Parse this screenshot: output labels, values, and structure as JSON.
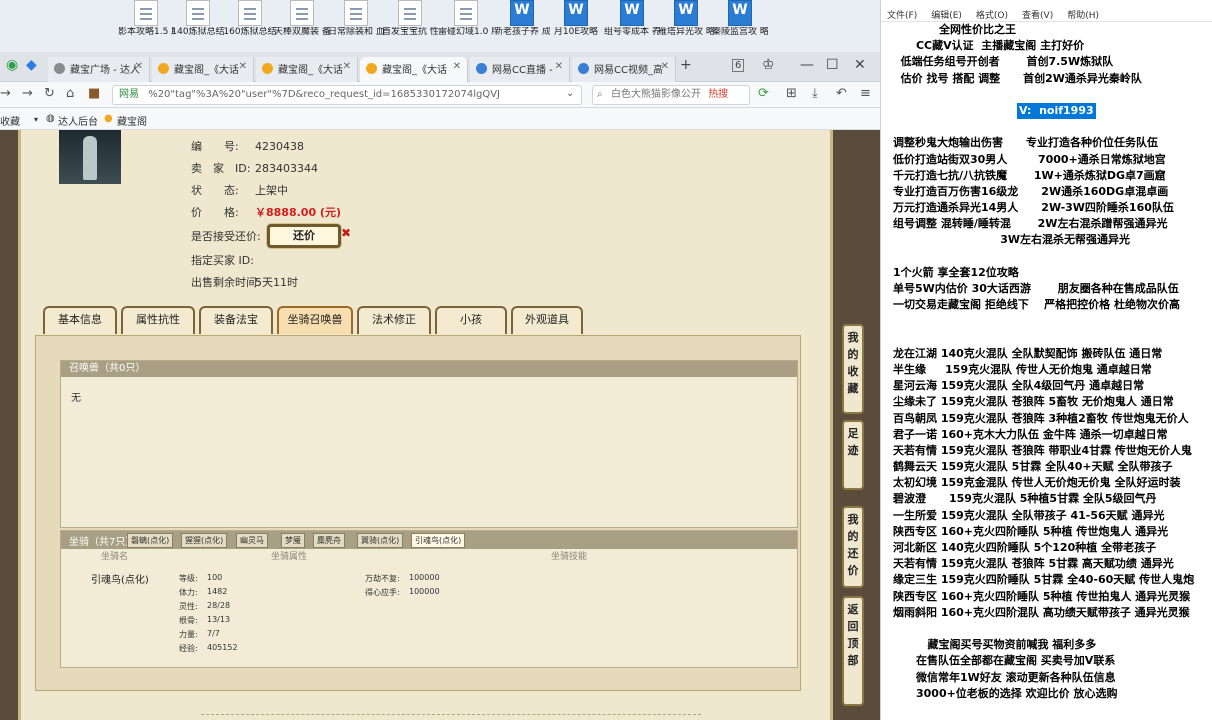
{
  "desktop": {
    "icons": [
      {
        "label": "影本攻略1.5 版本",
        "type": "doc"
      },
      {
        "label": "140炼狱总结",
        "type": "doc"
      },
      {
        "label": "160炼狱总结",
        "type": "doc"
      },
      {
        "label": "天棒双魔装 备搭配",
        "type": "doc"
      },
      {
        "label": "日常除装和 血血鬼搭配",
        "type": "doc"
      },
      {
        "label": "首发宝宝抗 性",
        "type": "doc"
      },
      {
        "label": "雷碰幻域1.0 版本",
        "type": "doc"
      },
      {
        "label": "新老孩子养 成攻略",
        "type": "word"
      },
      {
        "label": "月10E攻略",
        "type": "word"
      },
      {
        "label": "组号零成本 养号",
        "type": "word"
      },
      {
        "label": "雁塔异光攻 略",
        "type": "word"
      },
      {
        "label": "秦陵监宫攻 略",
        "type": "word"
      }
    ]
  },
  "browser": {
    "tabs": [
      {
        "label": "藏宝广场 - 达人",
        "favicon": "grey",
        "active": false
      },
      {
        "label": "藏宝阁_《大话",
        "favicon": "orange",
        "active": false
      },
      {
        "label": "藏宝阁_《大话",
        "favicon": "orange",
        "active": false
      },
      {
        "label": "藏宝阁_《大话",
        "favicon": "orange",
        "active": true
      },
      {
        "label": "网易CC直播 -",
        "favicon": "blue",
        "active": false
      },
      {
        "label": "网易CC视频_高",
        "favicon": "blue",
        "active": false
      }
    ],
    "new_tab": "+",
    "tab_count": "6",
    "address": {
      "secure_label": "网易",
      "url": "%20\"tag\"%3A%20\"user\"%7D&reco_request_id=1685330172074lgQVJ"
    },
    "search": {
      "value": "白色大熊猫影像公开",
      "hot": "热搜"
    },
    "bookmarks": [
      "收藏",
      "达人后台",
      "藏宝阁"
    ]
  },
  "item": {
    "rows": [
      {
        "label": "编　　号:",
        "value": "4230438"
      },
      {
        "label": "卖　家　ID:",
        "value": "283403344"
      },
      {
        "label": "状　　态:",
        "value": "上架中"
      },
      {
        "label": "价　　格:",
        "value": "￥8888.00 (元)"
      },
      {
        "label": "是否接受还价:",
        "value": ""
      },
      {
        "label": "指定买家 ID:",
        "value": ""
      },
      {
        "label": "出售剩余时间:",
        "value": "5天11时"
      }
    ],
    "counter_offer_button": "还价",
    "counter_offer_mark": "✖"
  },
  "tabs": [
    {
      "label": "基本信息"
    },
    {
      "label": "属性抗性"
    },
    {
      "label": "装备法宝"
    },
    {
      "label": "坐骑召唤兽",
      "active": true
    },
    {
      "label": "法术修正"
    },
    {
      "label": "小孩"
    },
    {
      "label": "外观道具"
    }
  ],
  "summon": {
    "title": "召唤兽（共0只）",
    "empty": "无"
  },
  "mount": {
    "title": "坐骑（共7只）",
    "tabs": [
      "磐螭(点化)",
      "猩猩(点化)",
      "幽灵马",
      "梦魇",
      "麋麂舟",
      "翼骑(点化)",
      "引魂鸟(点化)"
    ],
    "active_tab": "引魂鸟(点化)",
    "columns": [
      "坐骑名",
      "坐骑属性",
      "坐骑技能"
    ],
    "name": "引魂鸟(点化)",
    "stats": [
      {
        "label": "等级:",
        "value": "100"
      },
      {
        "label": "体力:",
        "value": "1482"
      },
      {
        "label": "灵性:",
        "value": "28/28"
      },
      {
        "label": "根骨:",
        "value": "13/13"
      },
      {
        "label": "力量:",
        "value": "7/7"
      },
      {
        "label": "经验:",
        "value": "405152"
      }
    ],
    "skills": [
      {
        "label": "万劫不复:",
        "value": "100000"
      },
      {
        "label": "得心应手:",
        "value": "100000"
      }
    ]
  },
  "side_buttons": [
    "我的收藏",
    "足迹",
    "我的还价",
    "返回顶部"
  ],
  "notepad": {
    "menu": [
      "文件(F)",
      "编辑(E)",
      "格式(O)",
      "查看(V)",
      "帮助(H)"
    ],
    "lines": [
      "            全网性价比之王",
      "      CC藏V认证  主播藏宝阁 主打好价",
      "  低端任务组号开创者       首创7.5W炼狱队",
      "  估价 找号 搭配 调整      首创2W通杀异光秦岭队",
      "",
      "",
      "调整秒鬼大炮输出伤害      专业打造各种价位任务队伍",
      "低价打造站街双30男人        7000+通杀日常炼狱地宫",
      "千元打造七抗/八抗铁魔       1W+通杀炼狱DG卓7画窟",
      "专业打造百万伤害16级龙      2W通杀160DG卓混卓画",
      "万元打造通杀异光14男人      2W-3W四阶睡杀160队伍",
      "组号调整 混转睡/睡转混       2W左右混杀蹭帮强通异光",
      "                            3W左右混杀无帮强通异光",
      "",
      "1个火箭 享全套12位攻略",
      "单号5W内估价 30大话西游       朋友圈各种在售成品队伍",
      "一切交易走藏宝阁 拒绝线下    严格把控价格 杜绝物次价高",
      "",
      "",
      "龙在江湖 140克火混队 全队默契配饰 搬砖队伍 通日常",
      "半生缘     159克火混队 传世人无价炮鬼 通卓越日常",
      "星河云海 159克火混队 全队4级回气丹 通卓越日常",
      "尘缘未了 159克火混队 苍狼阵 5畜牧 无价炮鬼人 通日常",
      "百鸟朝凤 159克火混队 苍狼阵 3种植2畜牧 传世炮鬼无价人",
      "君子一诺 160+克木大力队伍 金牛阵 通杀一切卓越日常",
      "天若有情 159克火混队 苍狼阵 带职业4甘霖 传世炮无价人鬼",
      "鹤舞云天 159克火混队 5甘霖 全队40+天赋 全队带孩子",
      "太初幻境 159克金混队 传世人无价炮无价鬼 全队好运时装",
      "碧波澄      159克火混队 5种植5甘霖 全队5级回气丹",
      "一生所爱 159克火混队 全队带孩子 41-56天赋 通异光",
      "陕西专区 160+克火四阶睡队 5种植 传世炮鬼人 通异光",
      "河北新区 140克火四阶睡队 5个120种植 全带老孩子",
      "天若有情 159克火混队 苍狼阵 5甘霖 高天赋功绩 通异光",
      "缘定三生 159克火四阶睡队 5甘霖 全40-60天赋 传世人鬼炮",
      "陕西专区 160+克火四阶睡队 5种植 传世拍鬼人 通异光灵猴",
      "烟雨斜阳 160+克火四阶混队 高功绩天赋带孩子 通异光灵猴",
      "",
      "         藏宝阁买号买物资前喊我 福利多多",
      "      在售队伍全部都在藏宝阁 买卖号加V联系",
      "      微信常年1W好友 滚动更新各种队伍信息",
      "      3000+位老板的选择 欢迎比价 放心选购"
    ],
    "selected": "V:  noif1993"
  }
}
